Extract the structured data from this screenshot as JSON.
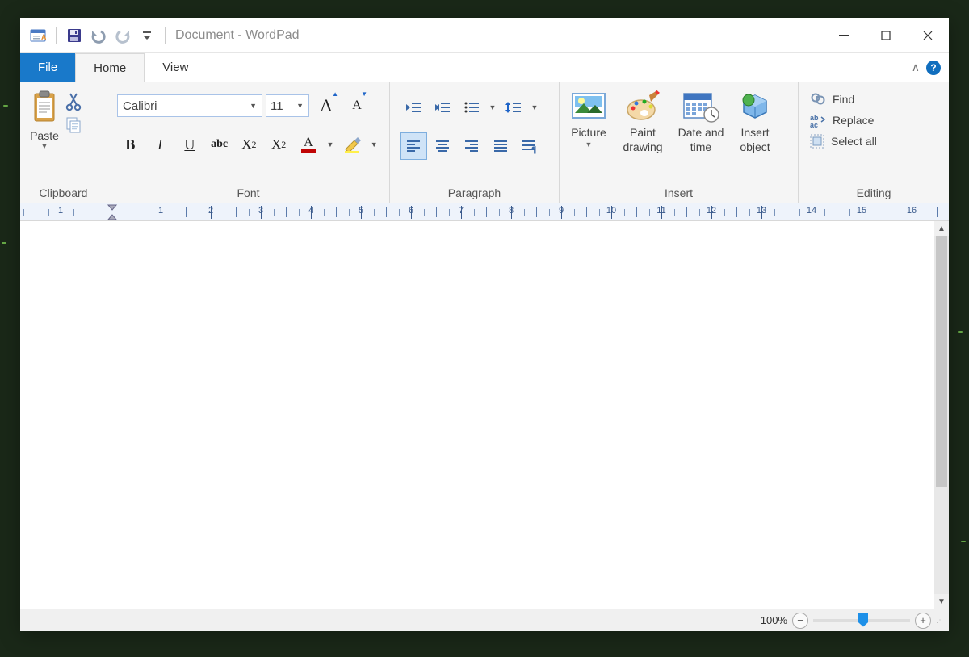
{
  "title": "Document - WordPad",
  "tabs": {
    "file": "File",
    "home": "Home",
    "view": "View"
  },
  "clipboard": {
    "paste": "Paste",
    "group": "Clipboard"
  },
  "font": {
    "group": "Font",
    "name": "Calibri",
    "size": "11"
  },
  "paragraph": {
    "group": "Paragraph"
  },
  "insert": {
    "group": "Insert",
    "picture": "Picture",
    "paint": "Paint drawing",
    "datetime": "Date and time",
    "object": "Insert object"
  },
  "editing": {
    "group": "Editing",
    "find": "Find",
    "replace": "Replace",
    "selectall": "Select all"
  },
  "ruler": {
    "start": -1,
    "end": 16
  },
  "status": {
    "zoom": "100%"
  }
}
